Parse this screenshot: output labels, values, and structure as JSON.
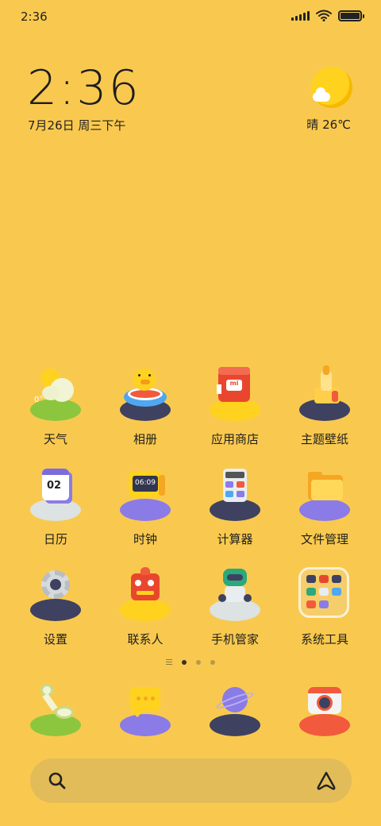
{
  "status_bar": {
    "time": "2:36",
    "battery_level": 1.0,
    "icons": [
      "signal-icon",
      "wifi-icon",
      "battery-icon"
    ]
  },
  "clock_widget": {
    "time": "2:36",
    "date": "7月26日 周三下午"
  },
  "weather_widget": {
    "text": "晴 26℃",
    "icon": "sunny-weather-icon"
  },
  "apps": [
    {
      "label": "天气",
      "icon": "weather-app-icon"
    },
    {
      "label": "相册",
      "icon": "gallery-duck-icon"
    },
    {
      "label": "应用商店",
      "icon": "app-store-icon"
    },
    {
      "label": "主题壁纸",
      "icon": "themes-brush-icon"
    },
    {
      "label": "日历",
      "icon": "calendar-icon"
    },
    {
      "label": "时钟",
      "icon": "clock-app-icon"
    },
    {
      "label": "计算器",
      "icon": "calculator-icon"
    },
    {
      "label": "文件管理",
      "icon": "folder-icon"
    },
    {
      "label": "设置",
      "icon": "settings-gear-icon"
    },
    {
      "label": "联系人",
      "icon": "contacts-robot-icon"
    },
    {
      "label": "手机管家",
      "icon": "security-robot-icon"
    },
    {
      "label": "系统工具",
      "icon": "system-tools-folder-icon"
    }
  ],
  "dock": [
    {
      "icon": "phone-icon"
    },
    {
      "icon": "messages-icon"
    },
    {
      "icon": "browser-planet-icon"
    },
    {
      "icon": "camera-icon"
    }
  ],
  "page_indicator": {
    "pages": 3,
    "current": 1
  },
  "search_bar": {
    "left_icon": "search-icon",
    "right_icon": "assistant-icon"
  },
  "colors": {
    "wallpaper": "#F9C94F",
    "search_bar": "#E2BC58",
    "text": "#1f1f1f"
  }
}
